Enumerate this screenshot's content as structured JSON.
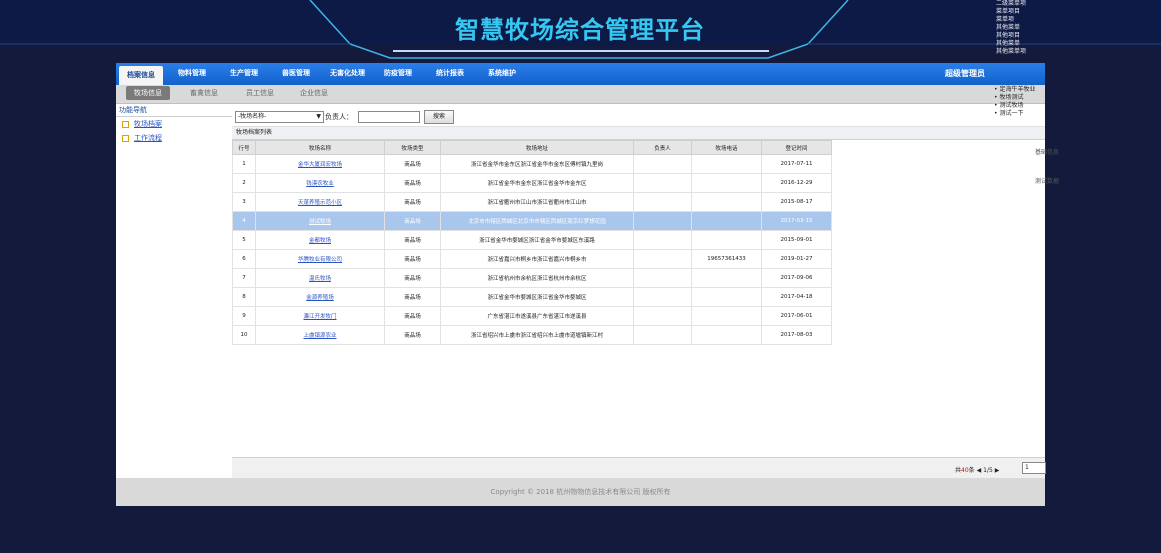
{
  "platform_title": "智慧牧场综合管理平台",
  "corner_items": [
    "二级菜单项",
    "菜单项目",
    "菜单项",
    "其他菜单",
    "其他项目",
    "其他菜单",
    "其他菜单项"
  ],
  "menu": [
    "档案信息",
    "物料管理",
    "生产管理",
    "兽医管理",
    "无害化处理",
    "防疫管理",
    "统计报表",
    "系统维护"
  ],
  "user_label": "超级管理员",
  "subtabs": [
    "牧场信息",
    "畜禽信息",
    "员工信息",
    "企业信息"
  ],
  "sidebar": {
    "title": "功能导航",
    "items": [
      "牧场档案",
      "工作流程"
    ]
  },
  "search": {
    "select_value": "-牧场名称-",
    "owner_label": "负责人：",
    "button": "搜索"
  },
  "table_title": "牧场档案列表",
  "columns": [
    "行号",
    "牧场名称",
    "牧场类型",
    "牧场地址",
    "负责人",
    "牧场电话",
    "登记时间"
  ],
  "rows": [
    [
      "1",
      "金华大厦润宏牧场",
      "商品场",
      "浙江省金华市金东区浙江省金华市金东区傅村镇九里岗",
      "",
      "",
      "2017-07-11"
    ],
    [
      "2",
      "钱漠农牧业",
      "商品场",
      "浙江省金华市金东区浙江省金华市金东区",
      "",
      "",
      "2016-12-29"
    ],
    [
      "3",
      "天蓬养殖示范小区",
      "商品场",
      "浙江省衢州市江山市浙江省衢州市江山市",
      "",
      "",
      "2015-08-17"
    ],
    [
      "4",
      "测试牧场",
      "商品场",
      "北京市市辖区西城区北京市市辖区西城区南京红梦想花园",
      "",
      "",
      "2017-03-15"
    ],
    [
      "5",
      "金都牧场",
      "商品场",
      "浙江省金华市婺城区浙江省金华市婺城区东溪路",
      "",
      "",
      "2015-09-01"
    ],
    [
      "6",
      "华腾牧业有限公司",
      "商品场",
      "浙江省嘉兴市桐乡市浙江省嘉兴市桐乡市",
      "",
      "19657361433",
      "2019-01-27"
    ],
    [
      "7",
      "温氏牧场",
      "商品场",
      "浙江省杭州市余杭区浙江省杭州市余杭区",
      "",
      "",
      "2017-09-06"
    ],
    [
      "8",
      "金源养殖场",
      "商品场",
      "浙江省金华市婺城区浙江省金华市婺城区",
      "",
      "",
      "2017-04-18"
    ],
    [
      "9",
      "濂江开发牧门",
      "商品场",
      "广东省湛江市遂溪县广东省湛江市遂溪县",
      "",
      "",
      "2017-06-01"
    ],
    [
      "10",
      "上虞镇源农业",
      "商品场",
      "浙江省绍兴市上虞市浙江省绍兴市上虞市道墟镇新江村",
      "",
      "",
      "2017-08-03"
    ]
  ],
  "selected_row": 4,
  "pager": {
    "total_prefix": "共",
    "total_count": "40",
    "total_suffix": "条",
    "page_info": "1/5",
    "page_value": "1"
  },
  "footer": "Copyright © 2018 杭州物物信息技术有限公司 版权所有",
  "float_menu": [
    "定海牛羊牧业",
    "牧场测试",
    "测试牧场",
    "测试一下"
  ],
  "right_texts": [
    "基础信息",
    "测试数据"
  ]
}
